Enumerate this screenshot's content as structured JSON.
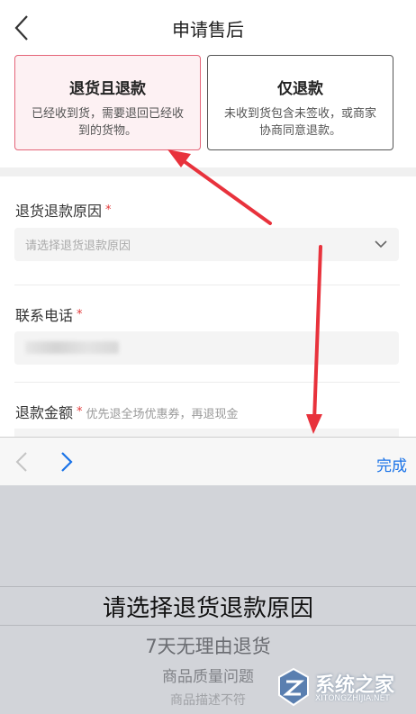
{
  "header": {
    "title": "申请售后"
  },
  "options": [
    {
      "title": "退货且退款",
      "desc": "已经收到货，需要退回已经收到的货物。",
      "selected": true
    },
    {
      "title": "仅退款",
      "desc": "未收到货包含未签收，或商家协商同意退款。",
      "selected": false
    }
  ],
  "form": {
    "reason_label": "退货退款原因",
    "reason_placeholder": "请选择退货退款原因",
    "phone_label": "联系电话",
    "amount_label": "退款金额",
    "amount_note": "优先退全场优惠券，再退现金",
    "required_mark": "*"
  },
  "toolbar": {
    "done_label": "完成"
  },
  "picker": {
    "selected": "请选择退货退款原因",
    "options": [
      "7天无理由退货",
      "商品质量问题",
      "商品描述不符"
    ]
  },
  "watermark": {
    "text": "系统之家",
    "url": "XITONGZHIJIA.NET"
  },
  "colors": {
    "accent_pink": "#e46478",
    "link_blue": "#1a73e8",
    "arrow_red": "#e8323c"
  }
}
